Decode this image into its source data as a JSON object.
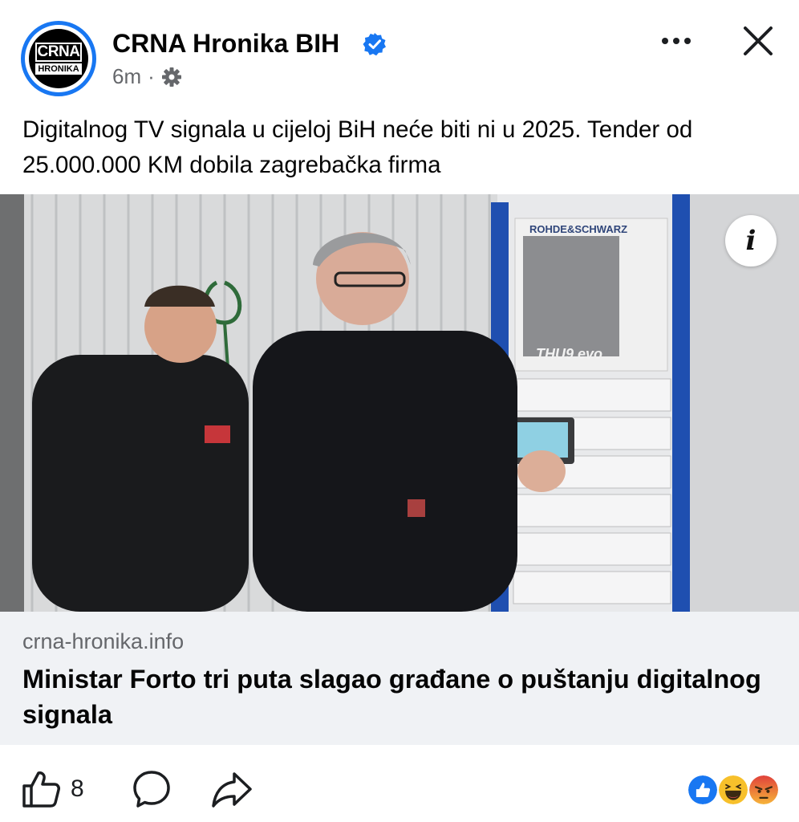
{
  "header": {
    "avatar_text_top": "CRNA",
    "avatar_text_bottom": "HRONIKA",
    "page_name": "CRNA Hronika BIH",
    "time_ago": "6m",
    "separator": "·",
    "verified_icon": "verified-badge-icon",
    "privacy_icon": "gear-icon",
    "more_icon": "more-options-icon",
    "close_icon": "close-icon"
  },
  "post": {
    "text": "Digitalnog TV signala u cijeloj BiH neće biti ni u 2025. Tender od 25.000.000 KM dobila zagrebačka firma",
    "image_info_label": "i",
    "image_equipment_brand": "ROHDE&SCHWARZ",
    "image_equipment_model": "THU9 evo"
  },
  "link_preview": {
    "domain": "crna-hronika.info",
    "title": "Ministar Forto tri puta slagao građane o puštanju digitalnog signala"
  },
  "footer": {
    "like_icon": "thumbs-up-icon",
    "like_count": "8",
    "comment_icon": "comment-icon",
    "share_icon": "share-icon",
    "reactions": [
      "like-reaction-icon",
      "haha-reaction-icon",
      "angry-reaction-icon"
    ]
  },
  "colors": {
    "accent": "#1877f2",
    "text_primary": "#050505",
    "text_secondary": "#65676b",
    "link_box_bg": "#f0f2f5"
  }
}
